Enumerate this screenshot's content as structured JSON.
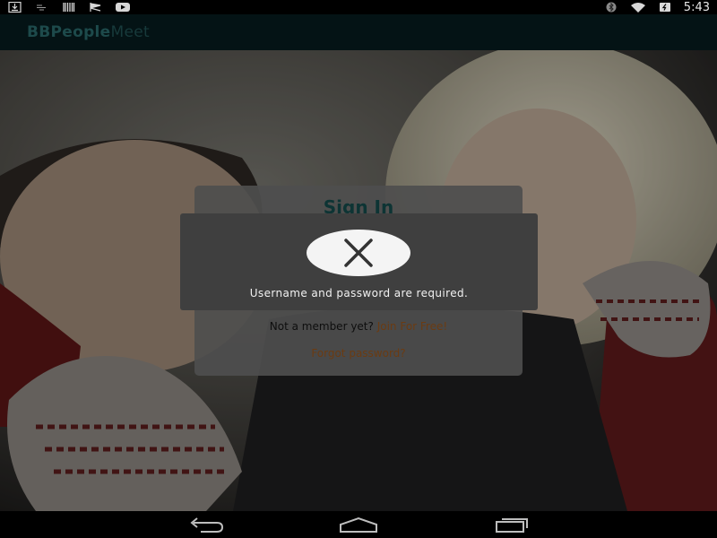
{
  "status_bar": {
    "time": "5:43",
    "left_icons": [
      "download-icon",
      "signal-bars-icon",
      "barcode-icon",
      "flag-icon",
      "youtube-icon"
    ],
    "right_icons": [
      "bluetooth-icon",
      "wifi-icon",
      "battery-icon"
    ]
  },
  "app_bar": {
    "title_part1": "BB",
    "title_part2": "People",
    "title_part3": "Meet"
  },
  "signin": {
    "title": "Sign In",
    "member_prompt": "Not a member yet?",
    "join_link": "Join For Free!",
    "forgot_link": "Forgot password?"
  },
  "error_dialog": {
    "icon": "close-icon",
    "message": "Username and password are required."
  },
  "nav_bar": {
    "buttons": [
      "back-icon",
      "home-icon",
      "recent-apps-icon"
    ]
  },
  "colors": {
    "app_bar_bg": "#041315",
    "title_teal": "#1d4a4b",
    "link_brown": "#6b3b12",
    "dialog_bg": "#3f3f3f",
    "card_bg": "#4e4e4e"
  }
}
